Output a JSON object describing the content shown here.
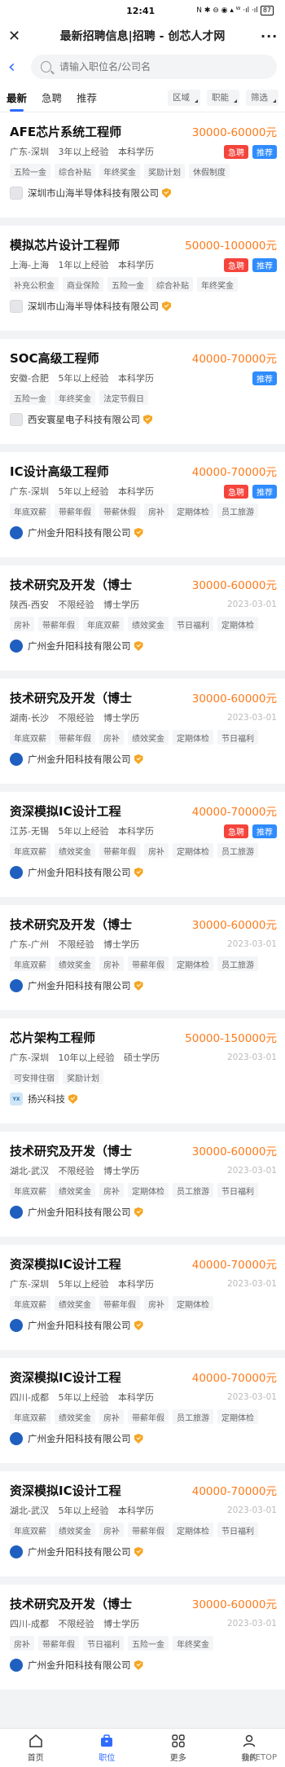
{
  "status_bar": {
    "time": "12:41",
    "icons": "N ✱ ⊖ ◉ ▴ ᵂ ·ıl ·ıl",
    "battery": "87"
  },
  "title_bar": {
    "title": "最新招聘信息|招聘 - 创芯人才网"
  },
  "search": {
    "placeholder": "请输入职位名/公司名"
  },
  "tabs": [
    "最新",
    "急聘",
    "推荐"
  ],
  "filters": [
    "区域",
    "职能",
    "筛选"
  ],
  "jobs": [
    {
      "title": "AFE芯片系统工程师",
      "salary": "30000-60000元",
      "location": "广东-深圳",
      "experience": "3年以上经验",
      "education": "本科学历",
      "urgent": "急聘",
      "recommended": "推荐",
      "date": "",
      "tags": [
        "五险一金",
        "综合补贴",
        "年终奖金",
        "奖励计划",
        "休假制度"
      ],
      "company": "深圳市山海半导体科技有限公司",
      "logo": "gray"
    },
    {
      "title": "模拟芯片设计工程师",
      "salary": "50000-100000元",
      "location": "上海-上海",
      "experience": "1年以上经验",
      "education": "本科学历",
      "urgent": "急聘",
      "recommended": "推荐",
      "date": "",
      "tags": [
        "补充公积金",
        "商业保险",
        "五险一金",
        "综合补贴",
        "年终奖金"
      ],
      "company": "深圳市山海半导体科技有限公司",
      "logo": "gray"
    },
    {
      "title": "SOC高级工程师",
      "salary": "40000-70000元",
      "location": "安徽-合肥",
      "experience": "5年以上经验",
      "education": "本科学历",
      "urgent": "",
      "recommended": "推荐",
      "date": "",
      "tags": [
        "五险一金",
        "年终奖金",
        "法定节假日"
      ],
      "company": "西安寰星电子科技有限公司",
      "logo": "gray"
    },
    {
      "title": "IC设计高级工程师",
      "salary": "40000-70000元",
      "location": "广东-深圳",
      "experience": "5年以上经验",
      "education": "本科学历",
      "urgent": "急聘",
      "recommended": "推荐",
      "date": "",
      "tags": [
        "年底双薪",
        "带薪年假",
        "带薪休假",
        "房补",
        "定期体检",
        "员工旅游"
      ],
      "company": "广州金升阳科技有限公司",
      "logo": "blue"
    },
    {
      "title": "技术研究及开发（博士",
      "salary": "30000-60000元",
      "location": "陕西-西安",
      "experience": "不限经验",
      "education": "博士学历",
      "urgent": "",
      "recommended": "",
      "date": "2023-03-01",
      "tags": [
        "房补",
        "带薪年假",
        "年底双薪",
        "绩效奖金",
        "节日福利",
        "定期体检"
      ],
      "company": "广州金升阳科技有限公司",
      "logo": "blue"
    },
    {
      "title": "技术研究及开发（博士",
      "salary": "30000-60000元",
      "location": "湖南-长沙",
      "experience": "不限经验",
      "education": "博士学历",
      "urgent": "",
      "recommended": "",
      "date": "2023-03-01",
      "tags": [
        "年底双薪",
        "带薪年假",
        "房补",
        "绩效奖金",
        "定期体检",
        "节日福利"
      ],
      "company": "广州金升阳科技有限公司",
      "logo": "blue"
    },
    {
      "title": "资深模拟IC设计工程",
      "salary": "40000-70000元",
      "location": "江苏-无锡",
      "experience": "5年以上经验",
      "education": "本科学历",
      "urgent": "急聘",
      "recommended": "推荐",
      "date": "",
      "tags": [
        "年底双薪",
        "绩效奖金",
        "带薪年假",
        "房补",
        "定期体检",
        "员工旅游"
      ],
      "company": "广州金升阳科技有限公司",
      "logo": "blue"
    },
    {
      "title": "技术研究及开发（博士",
      "salary": "30000-60000元",
      "location": "广东-广州",
      "experience": "不限经验",
      "education": "博士学历",
      "urgent": "",
      "recommended": "",
      "date": "2023-03-01",
      "tags": [
        "年底双薪",
        "绩效奖金",
        "房补",
        "带薪年假",
        "定期体检",
        "员工旅游"
      ],
      "company": "广州金升阳科技有限公司",
      "logo": "blue"
    },
    {
      "title": "芯片架构工程师",
      "salary": "50000-150000元",
      "location": "广东-深圳",
      "experience": "10年以上经验",
      "education": "硕士学历",
      "urgent": "",
      "recommended": "",
      "date": "2023-03-01",
      "tags": [
        "可安排住宿",
        "奖励计划"
      ],
      "company": "扬兴科技",
      "logo": "yx"
    },
    {
      "title": "技术研究及开发（博士",
      "salary": "30000-60000元",
      "location": "湖北-武汉",
      "experience": "不限经验",
      "education": "博士学历",
      "urgent": "",
      "recommended": "",
      "date": "2023-03-01",
      "tags": [
        "年底双薪",
        "绩效奖金",
        "房补",
        "定期体检",
        "员工旅游",
        "节日福利"
      ],
      "company": "广州金升阳科技有限公司",
      "logo": "blue"
    },
    {
      "title": "资深模拟IC设计工程",
      "salary": "40000-70000元",
      "location": "广东-深圳",
      "experience": "5年以上经验",
      "education": "本科学历",
      "urgent": "",
      "recommended": "",
      "date": "2023-03-01",
      "tags": [
        "年底双薪",
        "绩效奖金",
        "带薪年假",
        "房补",
        "定期体检"
      ],
      "company": "广州金升阳科技有限公司",
      "logo": "blue"
    },
    {
      "title": "资深模拟IC设计工程",
      "salary": "40000-70000元",
      "location": "四川-成都",
      "experience": "5年以上经验",
      "education": "本科学历",
      "urgent": "",
      "recommended": "",
      "date": "2023-03-01",
      "tags": [
        "年底双薪",
        "绩效奖金",
        "房补",
        "带薪年假",
        "员工旅游",
        "定期体检"
      ],
      "company": "广州金升阳科技有限公司",
      "logo": "blue"
    },
    {
      "title": "资深模拟IC设计工程",
      "salary": "40000-70000元",
      "location": "湖北-武汉",
      "experience": "5年以上经验",
      "education": "本科学历",
      "urgent": "",
      "recommended": "",
      "date": "2023-03-01",
      "tags": [
        "年底双薪",
        "绩效奖金",
        "房补",
        "带薪年假",
        "定期体检",
        "节日福利"
      ],
      "company": "广州金升阳科技有限公司",
      "logo": "blue"
    },
    {
      "title": "技术研究及开发（博士",
      "salary": "30000-60000元",
      "location": "四川-成都",
      "experience": "不限经验",
      "education": "博士学历",
      "urgent": "",
      "recommended": "",
      "date": "2023-03-01",
      "tags": [
        "房补",
        "带薪年假",
        "节日福利",
        "五险一金",
        "年终奖金"
      ],
      "company": "广州金升阳科技有限公司",
      "logo": "blue"
    }
  ],
  "bottom_nav": [
    {
      "label": "首页",
      "icon": "home-icon"
    },
    {
      "label": "职位",
      "icon": "briefcase-icon"
    },
    {
      "label": "更多",
      "icon": "grid-icon"
    },
    {
      "label": "我的",
      "icon": "user-icon"
    }
  ],
  "watermark": "@RETOP",
  "colors": {
    "accent": "#2f6bff",
    "salary": "#ff7a1a",
    "urgent": "#f5443c",
    "recommend": "#2f8cff",
    "verified": "#f5a623"
  }
}
